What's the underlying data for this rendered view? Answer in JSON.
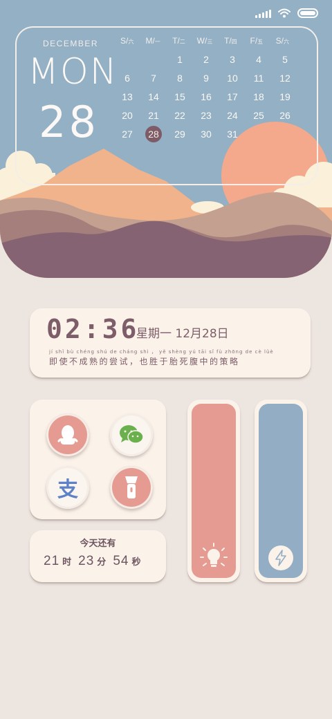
{
  "colors": {
    "background": "#ede5e0",
    "sky": "#93b0c5",
    "sun": "#f4a98c",
    "card": "#fbf3ea",
    "accent_text": "#7c5d69",
    "pink_tile": "#e59b92",
    "blue_tile": "#93aec4",
    "today_marker": "#7d5c68"
  },
  "status_bar": {
    "icons": [
      "signal-icon",
      "wifi-icon",
      "battery-icon"
    ],
    "battery_level": 1.0
  },
  "calendar": {
    "month": "DECEMBER",
    "weekday": "MON",
    "day": "28",
    "headers": [
      {
        "latin": "S/",
        "cjk": "六"
      },
      {
        "latin": "M/",
        "cjk": "一"
      },
      {
        "latin": "T/",
        "cjk": "二"
      },
      {
        "latin": "W/",
        "cjk": "三"
      },
      {
        "latin": "T/",
        "cjk": "四"
      },
      {
        "latin": "F/",
        "cjk": "五"
      },
      {
        "latin": "S/",
        "cjk": "六"
      }
    ],
    "weeks": [
      [
        "",
        "",
        "1",
        "2",
        "3",
        "4",
        "5"
      ],
      [
        "6",
        "7",
        "8",
        "9",
        "10",
        "11",
        "12"
      ],
      [
        "13",
        "14",
        "15",
        "16",
        "17",
        "18",
        "19"
      ],
      [
        "20",
        "21",
        "22",
        "23",
        "24",
        "25",
        "26"
      ],
      [
        "27",
        "28",
        "29",
        "30",
        "31",
        "",
        ""
      ]
    ],
    "today": "28"
  },
  "clock": {
    "time": "02:36",
    "date": "星期一  12月28日",
    "quote_pinyin": "jí shǐ bù chéng shú  de cháng shì ，  yě shèng yú tāi  sǐ  fù zhōng  de  cè  lüè",
    "quote": "即使不成熟的尝试，也胜于胎死腹中的策略"
  },
  "apps": [
    {
      "name": "qq",
      "icon": "penguin-icon"
    },
    {
      "name": "wechat",
      "icon": "wechat-icon"
    },
    {
      "name": "alipay",
      "icon": "alipay-icon",
      "glyph": "支"
    },
    {
      "name": "flashlight",
      "icon": "flashlight-icon"
    }
  ],
  "countdown": {
    "title": "今天还有",
    "hours": "21",
    "hours_unit": "时",
    "minutes": "23",
    "minutes_unit": "分",
    "seconds": "54",
    "seconds_unit": "秒"
  },
  "controls": {
    "brightness": {
      "icon": "lightbulb-icon",
      "level": 1.0
    },
    "power": {
      "icon": "lightning-icon",
      "level": 1.0
    }
  }
}
